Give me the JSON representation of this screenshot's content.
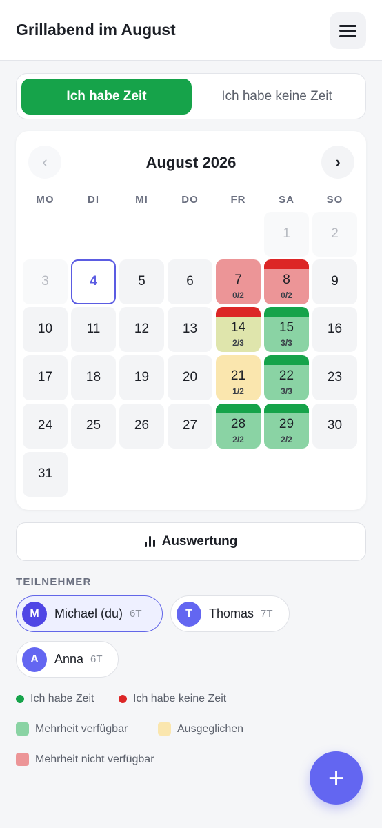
{
  "header": {
    "title": "Grillabend im August",
    "menu_icon": "hamburger-menu-icon"
  },
  "toggle": {
    "available_label": "Ich habe Zeit",
    "unavailable_label": "Ich habe keine Zeit",
    "selected": "available"
  },
  "calendar": {
    "month_label": "August 2026",
    "prev_glyph": "‹",
    "next_glyph": "›",
    "weekdays": [
      "MO",
      "DI",
      "MI",
      "DO",
      "FR",
      "SA",
      "SO"
    ],
    "days": [
      {
        "d": "1",
        "state": "muted"
      },
      {
        "d": "2",
        "state": "muted"
      },
      {
        "d": "3",
        "state": "muted"
      },
      {
        "d": "4",
        "state": "today"
      },
      {
        "d": "5"
      },
      {
        "d": "6"
      },
      {
        "d": "7",
        "state": "red",
        "count": "0/2"
      },
      {
        "d": "8",
        "state": "red",
        "bar": "red",
        "count": "0/2"
      },
      {
        "d": "9"
      },
      {
        "d": "10"
      },
      {
        "d": "11"
      },
      {
        "d": "12"
      },
      {
        "d": "13"
      },
      {
        "d": "14",
        "state": "olive",
        "bar": "red",
        "count": "2/3"
      },
      {
        "d": "15",
        "state": "green",
        "bar": "green",
        "count": "3/3"
      },
      {
        "d": "16"
      },
      {
        "d": "17"
      },
      {
        "d": "18"
      },
      {
        "d": "19"
      },
      {
        "d": "20"
      },
      {
        "d": "21",
        "state": "yellow",
        "count": "1/2"
      },
      {
        "d": "22",
        "state": "green",
        "bar": "green",
        "count": "3/3"
      },
      {
        "d": "23"
      },
      {
        "d": "24"
      },
      {
        "d": "25"
      },
      {
        "d": "26"
      },
      {
        "d": "27"
      },
      {
        "d": "28",
        "state": "green",
        "bar": "green",
        "count": "2/2"
      },
      {
        "d": "29",
        "state": "green",
        "bar": "green",
        "count": "2/2"
      },
      {
        "d": "30"
      },
      {
        "d": "31"
      }
    ]
  },
  "evaluation": {
    "label": "Auswertung",
    "icon": "bar-chart-icon"
  },
  "participants": {
    "section_label": "TEILNEHMER",
    "items": [
      {
        "initial": "M",
        "name": "Michael (du)",
        "count": "6T",
        "color": "#4f46e5",
        "is_self": true
      },
      {
        "initial": "T",
        "name": "Thomas",
        "count": "7T",
        "color": "#6366f1",
        "is_self": false
      },
      {
        "initial": "A",
        "name": "Anna",
        "count": "6T",
        "color": "#6366f1",
        "is_self": false
      }
    ]
  },
  "legend": {
    "available": "Ich habe Zeit",
    "unavailable": "Ich habe keine Zeit",
    "majority_available": "Mehrheit verfügbar",
    "balanced": "Ausgeglichen",
    "majority_unavailable": "Mehrheit nicht verfügbar"
  },
  "colors": {
    "accent": "#6366f1",
    "available": "#16a34a",
    "unavailable": "#dc2626",
    "majority_available": "#8ad3a4",
    "balanced": "#fae6ae",
    "majority_unavailable": "#ec9597"
  },
  "fab": {
    "glyph": "+"
  }
}
